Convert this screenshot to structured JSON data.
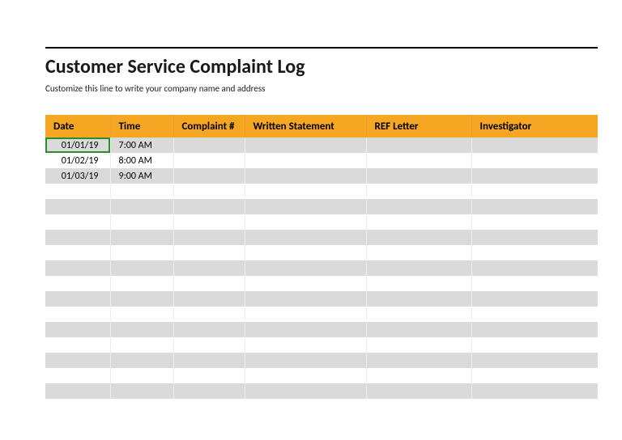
{
  "title": "Customer Service Complaint Log",
  "subtitle": "Customize this line to write your company name and address",
  "columns": {
    "date": "Date",
    "time": "Time",
    "complaint": "Complaint #",
    "statement": "Written Statement",
    "ref": "REF Letter",
    "investigator": "Investigator"
  },
  "rows": [
    {
      "date": "01/01/19",
      "time": "7:00 AM",
      "complaint": "",
      "statement": "",
      "ref": "",
      "investigator": ""
    },
    {
      "date": "01/02/19",
      "time": "8:00 AM",
      "complaint": "",
      "statement": "",
      "ref": "",
      "investigator": ""
    },
    {
      "date": "01/03/19",
      "time": "9:00 AM",
      "complaint": "",
      "statement": "",
      "ref": "",
      "investigator": ""
    },
    {
      "date": "",
      "time": "",
      "complaint": "",
      "statement": "",
      "ref": "",
      "investigator": ""
    },
    {
      "date": "",
      "time": "",
      "complaint": "",
      "statement": "",
      "ref": "",
      "investigator": ""
    },
    {
      "date": "",
      "time": "",
      "complaint": "",
      "statement": "",
      "ref": "",
      "investigator": ""
    },
    {
      "date": "",
      "time": "",
      "complaint": "",
      "statement": "",
      "ref": "",
      "investigator": ""
    },
    {
      "date": "",
      "time": "",
      "complaint": "",
      "statement": "",
      "ref": "",
      "investigator": ""
    },
    {
      "date": "",
      "time": "",
      "complaint": "",
      "statement": "",
      "ref": "",
      "investigator": ""
    },
    {
      "date": "",
      "time": "",
      "complaint": "",
      "statement": "",
      "ref": "",
      "investigator": ""
    },
    {
      "date": "",
      "time": "",
      "complaint": "",
      "statement": "",
      "ref": "",
      "investigator": ""
    },
    {
      "date": "",
      "time": "",
      "complaint": "",
      "statement": "",
      "ref": "",
      "investigator": ""
    },
    {
      "date": "",
      "time": "",
      "complaint": "",
      "statement": "",
      "ref": "",
      "investigator": ""
    },
    {
      "date": "",
      "time": "",
      "complaint": "",
      "statement": "",
      "ref": "",
      "investigator": ""
    },
    {
      "date": "",
      "time": "",
      "complaint": "",
      "statement": "",
      "ref": "",
      "investigator": ""
    },
    {
      "date": "",
      "time": "",
      "complaint": "",
      "statement": "",
      "ref": "",
      "investigator": ""
    },
    {
      "date": "",
      "time": "",
      "complaint": "",
      "statement": "",
      "ref": "",
      "investigator": ""
    }
  ],
  "selected_cell": {
    "row": 0,
    "col": "date"
  }
}
